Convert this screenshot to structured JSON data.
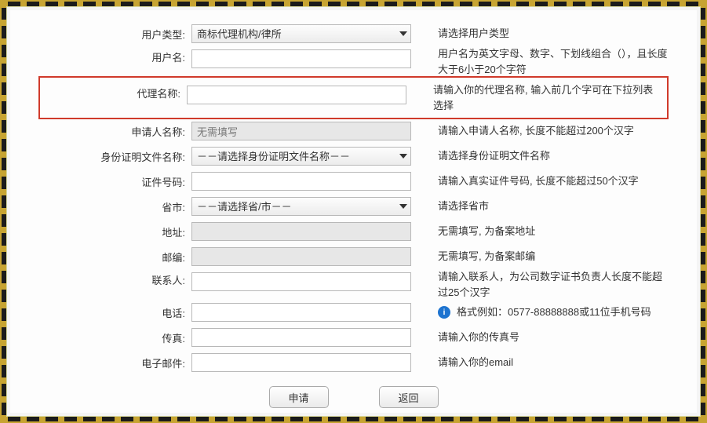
{
  "fields": {
    "user_type": {
      "label": "用户类型:",
      "value": "商标代理机构/律所",
      "hint": "请选择用户类型"
    },
    "username": {
      "label": "用户名:",
      "value": "",
      "hint": "用户名为英文字母、数字、下划线组合（），且长度大于6小于20个字符"
    },
    "agent_name": {
      "label": "代理名称:",
      "value": "",
      "hint": "请输入你的代理名称, 输入前几个字可在下拉列表选择"
    },
    "applicant": {
      "label": "申请人名称:",
      "value": "无需填写",
      "hint": "请输入申请人名称, 长度不能超过200个汉字"
    },
    "id_doc": {
      "label": "身份证明文件名称:",
      "value": "－－请选择身份证明文件名称－－",
      "hint": "请选择身份证明文件名称"
    },
    "id_number": {
      "label": "证件号码:",
      "value": "",
      "hint": "请输入真实证件号码, 长度不能超过50个汉字"
    },
    "province": {
      "label": "省市:",
      "value": "－－请选择省/市－－",
      "hint": "请选择省市"
    },
    "address": {
      "label": "地址:",
      "value": "",
      "hint": "无需填写, 为备案地址"
    },
    "postcode": {
      "label": "邮编:",
      "value": "",
      "hint": "无需填写, 为备案邮编"
    },
    "contact": {
      "label": "联系人:",
      "value": "",
      "hint": "请输入联系人，为公司数字证书负责人长度不能超过25个汉字"
    },
    "phone": {
      "label": "电话:",
      "value": "",
      "hint": "格式例如：0577-88888888或11位手机号码"
    },
    "fax": {
      "label": "传真:",
      "value": "",
      "hint": "请输入你的传真号"
    },
    "email": {
      "label": "电子邮件:",
      "value": "",
      "hint": "请输入你的email"
    }
  },
  "buttons": {
    "submit": "申请",
    "back": "返回"
  }
}
